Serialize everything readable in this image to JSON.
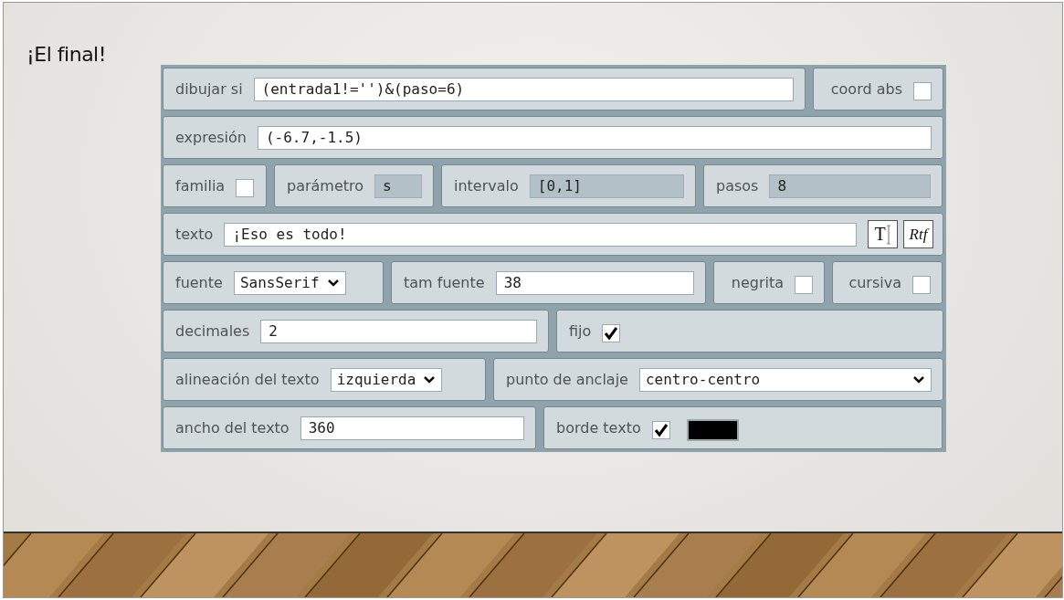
{
  "slide": {
    "title": "¡El final!"
  },
  "panel": {
    "rows": [
      {
        "groups": [
          {
            "kind": "text",
            "label": "dibujar si",
            "value": "(entrada1!='')&(paso=6)"
          },
          {
            "kind": "checkbox",
            "label": "coord abs",
            "checked": false
          }
        ]
      },
      {
        "groups": [
          {
            "kind": "text",
            "label": "expresión",
            "value": "(-6.7,-1.5)"
          }
        ]
      },
      {
        "groups": [
          {
            "kind": "checkbox",
            "label": "familia",
            "checked": false
          },
          {
            "kind": "readonly",
            "label": "parámetro",
            "value": "s"
          },
          {
            "kind": "readonly",
            "label": "intervalo",
            "value": "[0,1]"
          },
          {
            "kind": "readonly",
            "label": "pasos",
            "value": "8"
          }
        ]
      },
      {
        "groups": [
          {
            "kind": "text-buttons",
            "label": "texto",
            "value": "¡Eso es todo!",
            "buttons": [
              "T",
              "Rtf"
            ]
          }
        ]
      },
      {
        "groups": [
          {
            "kind": "select",
            "label": "fuente",
            "value": "SansSerif"
          },
          {
            "kind": "text",
            "label": "tam fuente",
            "value": "38"
          },
          {
            "kind": "checkbox",
            "label": "negrita",
            "checked": false
          },
          {
            "kind": "checkbox",
            "label": "cursiva",
            "checked": false
          }
        ]
      },
      {
        "groups": [
          {
            "kind": "text",
            "label": "decimales",
            "value": "2"
          },
          {
            "kind": "checkbox",
            "label": "fijo",
            "checked": true
          }
        ]
      },
      {
        "groups": [
          {
            "kind": "select",
            "label": "alineación del texto",
            "value": "izquierda"
          },
          {
            "kind": "select",
            "label": "punto de anclaje",
            "value": "centro-centro"
          }
        ]
      },
      {
        "groups": [
          {
            "kind": "text",
            "label": "ancho del texto",
            "value": "360"
          },
          {
            "kind": "checkbox-color",
            "label": "borde texto",
            "checked": true,
            "color": "#000000"
          }
        ]
      }
    ]
  }
}
